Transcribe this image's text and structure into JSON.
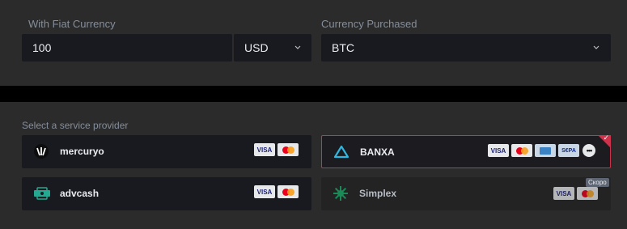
{
  "fiat": {
    "label": "With Fiat Currency",
    "amount": "100",
    "currency": "USD"
  },
  "crypto": {
    "label": "Currency Purchased",
    "currency": "BTC"
  },
  "providers": {
    "label": "Select a service provider",
    "items": [
      {
        "name": "mercuryo",
        "payments": [
          "VISA",
          "mastercard"
        ]
      },
      {
        "name": "BANXA",
        "payments": [
          "VISA",
          "mastercard",
          "bank-transfer",
          "SEPA",
          "more"
        ],
        "selected": true
      },
      {
        "name": "advcash",
        "payments": [
          "VISA",
          "mastercard"
        ]
      },
      {
        "name": "Simplex",
        "payments": [
          "VISA",
          "mastercard"
        ],
        "badge": "Скоро",
        "disabled": true
      }
    ]
  },
  "payment_labels": {
    "visa": "VISA",
    "sepa": "S€PA",
    "more": "•••"
  },
  "colors": {
    "background": "#2b2b2b",
    "field": "#181a20",
    "selected_border": "#cf304a",
    "banxa_logo": "#2fb6e0",
    "advcash_logo": "#25a891",
    "simplex_logo": "#1a8a57"
  }
}
